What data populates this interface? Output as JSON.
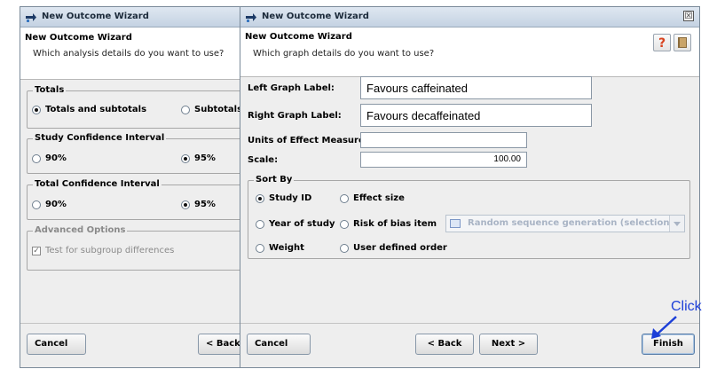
{
  "left_window": {
    "title": "New Outcome Wizard",
    "header_title": "New Outcome Wizard",
    "header_subtitle": "Which analysis details do you want to use?",
    "totals": {
      "legend": "Totals",
      "opt1": "Totals and subtotals",
      "opt2": "Subtotals"
    },
    "study_ci": {
      "legend": "Study Confidence Interval",
      "opt1": "90%",
      "opt2": "95%"
    },
    "total_ci": {
      "legend": "Total Confidence Interval",
      "opt1": "90%",
      "opt2": "95%"
    },
    "advanced": {
      "legend": "Advanced Options",
      "checkbox": "Test for subgroup differences"
    },
    "cancel": "Cancel",
    "back": "< Back"
  },
  "right_window": {
    "title": "New Outcome Wizard",
    "close_glyph": "☒",
    "header_title": "New Outcome Wizard",
    "header_subtitle": "Which graph details do you want to use?",
    "left_graph_label": "Left Graph Label:",
    "left_graph_value": "Favours caffeinated",
    "right_graph_label": "Right Graph Label:",
    "right_graph_value": "Favours decaffeinated",
    "units_label": "Units of Effect Measure:",
    "units_value": "",
    "scale_label": "Scale:",
    "scale_value": "100.00",
    "sort_by": {
      "legend": "Sort By",
      "study_id": "Study ID",
      "effect_size": "Effect size",
      "year": "Year of study",
      "risk_of_bias": "Risk of bias item",
      "weight": "Weight",
      "user_defined": "User defined order",
      "risk_combo": "Random sequence generation (selection bias)"
    },
    "cancel": "Cancel",
    "back": "< Back",
    "next": "Next >",
    "finish": "Finish"
  },
  "annotation": {
    "text": "Click",
    "color": "#1c3fd8"
  },
  "icons": [
    "wizard-icon",
    "help-icon",
    "book-icon",
    "close-icon",
    "arrow-icon"
  ]
}
